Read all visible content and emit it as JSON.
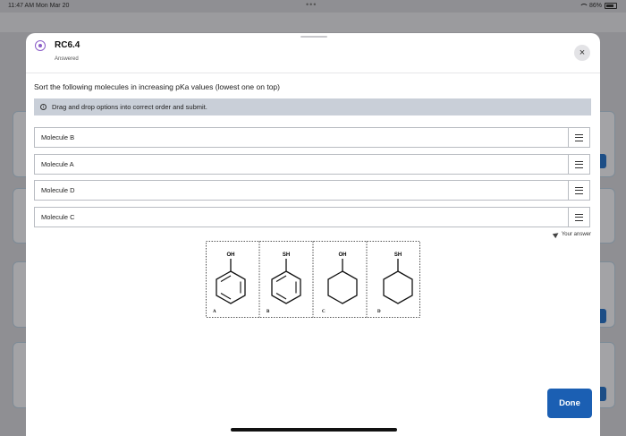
{
  "status_bar": {
    "time": "11:47 AM  Mon Mar 20",
    "dots": "•••",
    "battery": "86%"
  },
  "modal": {
    "title": "RC6.4",
    "subtitle": "Answered",
    "close_icon": "×",
    "question": "Sort the following molecules in increasing pKa values (lowest one on top)",
    "info_icon": "i",
    "info": "Drag and drop options into correct order and submit.",
    "options": [
      "Molecule B",
      "Molecule A",
      "Molecule D",
      "Molecule C"
    ],
    "your_answer": "Your answer",
    "done": "Done"
  },
  "figure": {
    "panels": [
      {
        "group": "OH",
        "letter": "A",
        "ring": "benzene"
      },
      {
        "group": "SH",
        "letter": "B",
        "ring": "benzene"
      },
      {
        "group": "OH",
        "letter": "C",
        "ring": "cyclohexane"
      },
      {
        "group": "SH",
        "letter": "D",
        "ring": "cyclohexane"
      }
    ]
  },
  "colors": {
    "accent": "#1b5fb3",
    "info_bg": "#c9cfd8",
    "icon_purple": "#8a5cc7"
  }
}
